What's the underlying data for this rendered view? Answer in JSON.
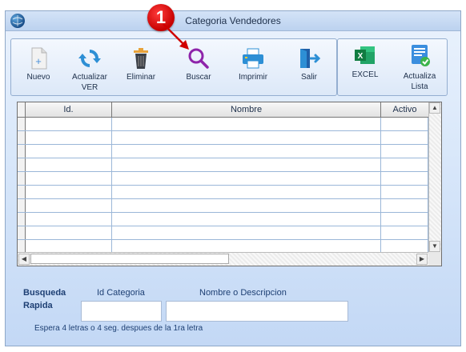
{
  "window": {
    "title": "Categoria Vendedores"
  },
  "toolbar": {
    "buttons": [
      {
        "label": "Nuevo",
        "icon": "new-document-icon"
      },
      {
        "label": "Actualizar VER",
        "icon": "refresh-icon"
      },
      {
        "label": "Eliminar",
        "icon": "trash-icon"
      },
      {
        "label": "Buscar",
        "icon": "search-icon"
      },
      {
        "label": "Imprimir",
        "icon": "printer-icon"
      },
      {
        "label": "Salir",
        "icon": "exit-icon"
      }
    ],
    "extra": [
      {
        "label": "EXCEL",
        "icon": "excel-icon"
      },
      {
        "label": "Actualiza Lista",
        "icon": "update-list-icon"
      }
    ]
  },
  "grid": {
    "columns": [
      "Id.",
      "Nombre",
      "Activo"
    ],
    "rows": 10
  },
  "search": {
    "title_line1": "Busqueda",
    "title_line2": "Rapida",
    "id_label": "Id Categoria",
    "name_label": "Nombre o Descripcion",
    "id_value": "",
    "name_value": "",
    "hint": "Espera 4 letras o 4 seg. despues de la 1ra letra"
  },
  "annotation": {
    "step": "1"
  },
  "colors": {
    "accent": "#2f6fc0",
    "badge": "#d00000",
    "excel": "#1e7145"
  }
}
